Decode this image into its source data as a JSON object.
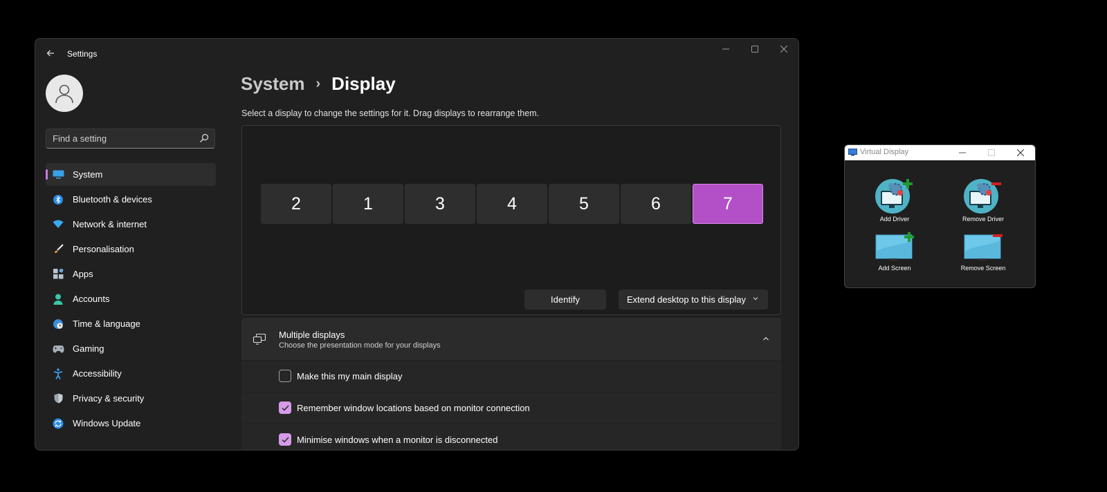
{
  "settings": {
    "app_title": "Settings",
    "search_placeholder": "Find a setting",
    "nav": [
      {
        "label": "System",
        "icon": "monitor-icon",
        "active": true
      },
      {
        "label": "Bluetooth & devices",
        "icon": "bluetooth-icon"
      },
      {
        "label": "Network & internet",
        "icon": "wifi-icon"
      },
      {
        "label": "Personalisation",
        "icon": "brush-icon"
      },
      {
        "label": "Apps",
        "icon": "apps-icon"
      },
      {
        "label": "Accounts",
        "icon": "person-icon"
      },
      {
        "label": "Time & language",
        "icon": "globe-clock-icon"
      },
      {
        "label": "Gaming",
        "icon": "gamepad-icon"
      },
      {
        "label": "Accessibility",
        "icon": "accessibility-icon"
      },
      {
        "label": "Privacy & security",
        "icon": "shield-icon"
      },
      {
        "label": "Windows Update",
        "icon": "update-icon"
      }
    ],
    "breadcrumb": {
      "parent": "System",
      "separator": "›",
      "current": "Display"
    },
    "instruction": "Select a display to change the settings for it. Drag displays to rearrange them.",
    "monitors": [
      {
        "label": "2"
      },
      {
        "label": "1"
      },
      {
        "label": "3"
      },
      {
        "label": "4"
      },
      {
        "label": "5"
      },
      {
        "label": "6"
      },
      {
        "label": "7",
        "selected": true
      }
    ],
    "identify_label": "Identify",
    "display_mode": "Extend desktop to this display",
    "multiple_displays": {
      "title": "Multiple displays",
      "subtitle": "Choose the presentation mode for your displays",
      "options": [
        {
          "label": "Make this my main display",
          "checked": false
        },
        {
          "label": "Remember window locations based on monitor connection",
          "checked": true
        },
        {
          "label": "Minimise windows when a monitor is disconnected",
          "checked": true
        }
      ]
    },
    "accent_color": "#b350c7"
  },
  "virtual_display": {
    "title": "Virtual Display",
    "buttons": {
      "add_driver": "Add Driver",
      "remove_driver": "Remove Driver",
      "add_screen": "Add Screen",
      "remove_screen": "Remove Screen"
    }
  }
}
